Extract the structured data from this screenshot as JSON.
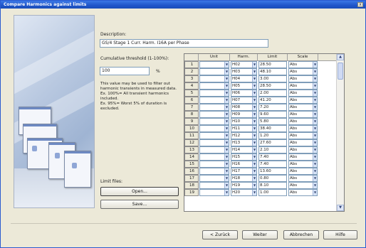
{
  "window": {
    "title": "Compare Harmonics against limits",
    "close_label": "x"
  },
  "description": {
    "label": "Description:",
    "value": "GS/4 Stage 1 Curr. Harm. I16A per Phase"
  },
  "threshold": {
    "label": "Cumulative threshold (1-100%):",
    "value": "100",
    "unit": "%",
    "help": "This value may be used to filter out harmonic transients in measured data.\nEx. 100%= All transient harmonics included.\nEx. 95%= Worst 5% of duration is excluded."
  },
  "limit_files": {
    "label": "Limit files:",
    "open_label": "Open...",
    "save_label": "Save..."
  },
  "grid": {
    "columns": [
      "Unit",
      "Harm.",
      "Limit",
      "Scale"
    ],
    "rows": [
      {
        "num": "1",
        "unit": "",
        "harm": "H02",
        "limit": "28.50",
        "scale": "Abs"
      },
      {
        "num": "2",
        "unit": "",
        "harm": "H03",
        "limit": "48.10",
        "scale": "Abs"
      },
      {
        "num": "3",
        "unit": "",
        "harm": "H04",
        "limit": "3.00",
        "scale": "Abs"
      },
      {
        "num": "4",
        "unit": "",
        "harm": "H05",
        "limit": "28.50",
        "scale": "Abs"
      },
      {
        "num": "5",
        "unit": "",
        "harm": "H06",
        "limit": "2.00",
        "scale": "Abs"
      },
      {
        "num": "6",
        "unit": "",
        "harm": "H07",
        "limit": "41.20",
        "scale": "Abs"
      },
      {
        "num": "7",
        "unit": "",
        "harm": "H08",
        "limit": "7.20",
        "scale": "Abs"
      },
      {
        "num": "8",
        "unit": "",
        "harm": "H09",
        "limit": "9.60",
        "scale": "Abs"
      },
      {
        "num": "9",
        "unit": "",
        "harm": "H10",
        "limit": "5.80",
        "scale": "Abs"
      },
      {
        "num": "10",
        "unit": "",
        "harm": "H11",
        "limit": "38.40",
        "scale": "Abs"
      },
      {
        "num": "11",
        "unit": "",
        "harm": "H12",
        "limit": "1.20",
        "scale": "Abs"
      },
      {
        "num": "12",
        "unit": "",
        "harm": "H13",
        "limit": "27.60",
        "scale": "Abs"
      },
      {
        "num": "13",
        "unit": "",
        "harm": "H14",
        "limit": "2.10",
        "scale": "Abs"
      },
      {
        "num": "14",
        "unit": "",
        "harm": "H15",
        "limit": "7.40",
        "scale": "Abs"
      },
      {
        "num": "15",
        "unit": "",
        "harm": "H16",
        "limit": "7.40",
        "scale": "Abs"
      },
      {
        "num": "16",
        "unit": "",
        "harm": "H17",
        "limit": "13.60",
        "scale": "Abs"
      },
      {
        "num": "17",
        "unit": "",
        "harm": "H18",
        "limit": "0.80",
        "scale": "Abs"
      },
      {
        "num": "18",
        "unit": "",
        "harm": "H19",
        "limit": "8.10",
        "scale": "Abs"
      },
      {
        "num": "19",
        "unit": "",
        "harm": "H20",
        "limit": "1.00",
        "scale": "Abs"
      }
    ]
  },
  "footer": {
    "back_label": "< Zurück",
    "next_label": "Weiter",
    "cancel_label": "Abbrechen",
    "help_label": "Hilfe"
  },
  "icons": {
    "dropdown": "chevron-down-icon",
    "scroll_up": "arrow-up-icon",
    "scroll_down": "arrow-down-icon"
  },
  "colors": {
    "titlebar": "#1f55c9",
    "dialog": "#ece9d8",
    "input_border": "#7f9db9"
  }
}
